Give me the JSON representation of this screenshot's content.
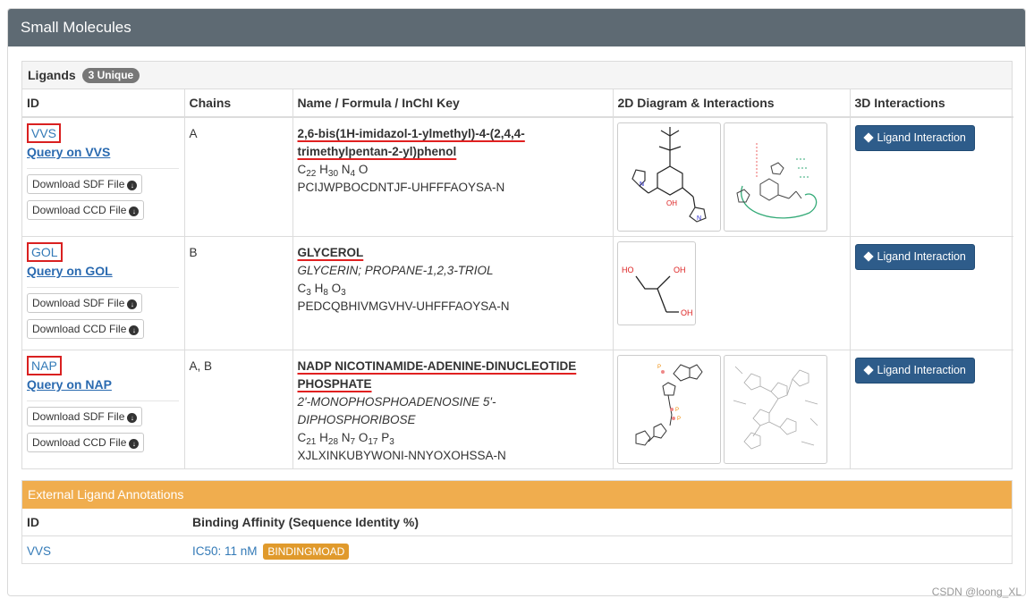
{
  "panel": {
    "title": "Small Molecules"
  },
  "ligands": {
    "title": "Ligands",
    "badge": "3 Unique",
    "columns": [
      "ID",
      "Chains",
      "Name / Formula / InChI Key",
      "2D Diagram & Interactions",
      "3D Interactions"
    ],
    "rows": [
      {
        "id": "VVS",
        "query": "Query on VVS",
        "sdf_label": "Download SDF File",
        "ccd_label": "Download CCD File",
        "chains": "A",
        "name_line1": "2,6-bis(1H-imidazol-1-ylmethyl)-4-(2,4,4-",
        "name_line2": "trimethylpentan-2-yl)phenol",
        "synonyms": "",
        "formula": [
          [
            "C",
            "22"
          ],
          [
            "H",
            "30"
          ],
          [
            "N",
            "4"
          ],
          [
            "O",
            ""
          ]
        ],
        "inchi": "PCIJWPBOCDNTJF-UHFFFAOYSA-N",
        "button": "Ligand Interaction"
      },
      {
        "id": "GOL",
        "query": "Query on GOL",
        "sdf_label": "Download SDF File",
        "ccd_label": "Download CCD File",
        "chains": "B",
        "name_line1": "GLYCEROL",
        "name_line2": "",
        "synonyms": "GLYCERIN; PROPANE-1,2,3-TRIOL",
        "formula": [
          [
            "C",
            "3"
          ],
          [
            "H",
            "8"
          ],
          [
            "O",
            "3"
          ]
        ],
        "inchi": "PEDCQBHIVMGVHV-UHFFFAOYSA-N",
        "button": "Ligand Interaction"
      },
      {
        "id": "NAP",
        "query": "Query on NAP",
        "sdf_label": "Download SDF File",
        "ccd_label": "Download CCD File",
        "chains": "A, B",
        "name_line1": "NADP NICOTINAMIDE-ADENINE-DINUCLEOTIDE",
        "name_line2": "PHOSPHATE",
        "synonyms": "2'-MONOPHOSPHOADENOSINE 5'-DIPHOSPHORIBOSE",
        "formula": [
          [
            "C",
            "21"
          ],
          [
            "H",
            "28"
          ],
          [
            "N",
            "7"
          ],
          [
            "O",
            "17"
          ],
          [
            "P",
            "3"
          ]
        ],
        "inchi": "XJLXINKUBYWONI-NNYOXOHSSA-N",
        "button": "Ligand Interaction"
      }
    ]
  },
  "external": {
    "title": "External Ligand Annotations",
    "col_id": "ID",
    "col_affinity": "Binding Affinity (Sequence Identity %)",
    "row": {
      "id": "VVS",
      "affinity": "IC50: 11 nM",
      "source": "BINDINGMOAD"
    }
  },
  "watermark": "CSDN @loong_XL"
}
